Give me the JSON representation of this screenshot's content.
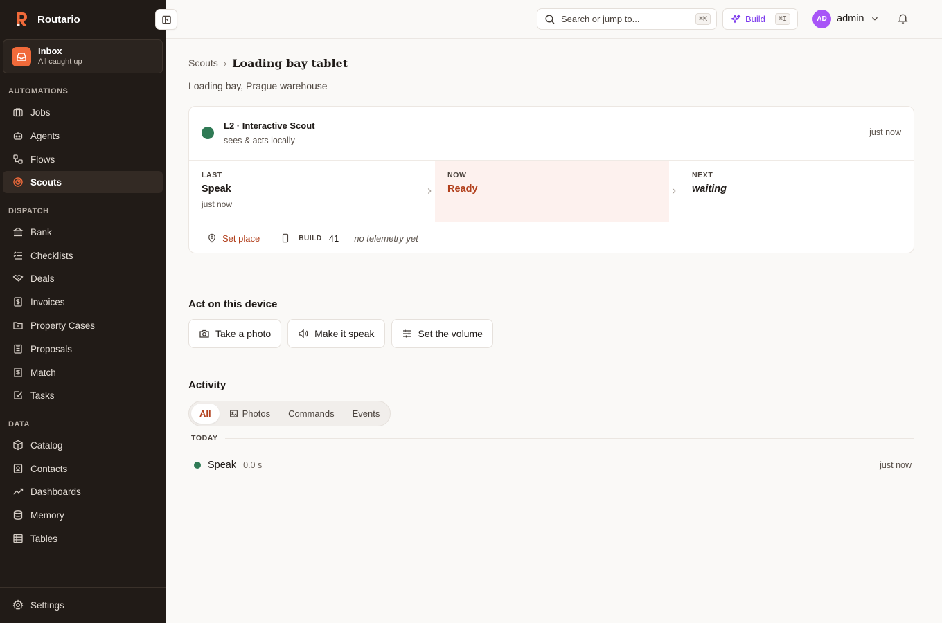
{
  "app": {
    "name": "Routario"
  },
  "sidebar": {
    "inbox": {
      "title": "Inbox",
      "subtitle": "All caught up"
    },
    "sections": [
      {
        "label": "AUTOMATIONS",
        "items": [
          {
            "label": "Jobs",
            "icon": "briefcase-icon"
          },
          {
            "label": "Agents",
            "icon": "bot-icon"
          },
          {
            "label": "Flows",
            "icon": "workflow-icon"
          },
          {
            "label": "Scouts",
            "icon": "radar-icon",
            "active": true
          }
        ]
      },
      {
        "label": "DISPATCH",
        "items": [
          {
            "label": "Bank",
            "icon": "bank-icon"
          },
          {
            "label": "Checklists",
            "icon": "checklist-icon"
          },
          {
            "label": "Deals",
            "icon": "handshake-icon"
          },
          {
            "label": "Invoices",
            "icon": "invoice-icon"
          },
          {
            "label": "Property Cases",
            "icon": "folder-icon"
          },
          {
            "label": "Proposals",
            "icon": "clipboard-icon"
          },
          {
            "label": "Match",
            "icon": "dollar-doc-icon"
          },
          {
            "label": "Tasks",
            "icon": "task-check-icon"
          }
        ]
      },
      {
        "label": "DATA",
        "items": [
          {
            "label": "Catalog",
            "icon": "box-icon"
          },
          {
            "label": "Contacts",
            "icon": "contact-icon"
          },
          {
            "label": "Dashboards",
            "icon": "trend-icon"
          },
          {
            "label": "Memory",
            "icon": "database-icon"
          },
          {
            "label": "Tables",
            "icon": "table-icon"
          }
        ]
      }
    ],
    "settings": {
      "label": "Settings",
      "icon": "gear-icon"
    }
  },
  "topbar": {
    "search_placeholder": "Search or jump to...",
    "search_shortcut": "⌘K",
    "build_label": "Build",
    "build_shortcut": "⌘I",
    "user_initials": "AD",
    "user_name": "admin"
  },
  "page": {
    "breadcrumb_parent": "Scouts",
    "breadcrumb_sep": "›",
    "title": "Loading bay tablet",
    "subtitle": "Loading bay, Prague warehouse"
  },
  "scout_card": {
    "type": "L2 · Interactive Scout",
    "description": "sees & acts locally",
    "updated": "just now",
    "status_color": "#2f7a55",
    "last": {
      "label": "LAST",
      "value": "Speak",
      "time": "just now"
    },
    "now": {
      "label": "NOW",
      "value": "Ready"
    },
    "next": {
      "label": "NEXT",
      "value": "waiting"
    },
    "set_place": "Set place",
    "build_label": "BUILD",
    "build_number": "41",
    "telemetry": "no telemetry yet"
  },
  "actions": {
    "title": "Act on this device",
    "buttons": [
      {
        "label": "Take a photo",
        "icon": "camera-icon"
      },
      {
        "label": "Make it speak",
        "icon": "speaker-icon"
      },
      {
        "label": "Set the volume",
        "icon": "sliders-icon"
      }
    ]
  },
  "activity": {
    "title": "Activity",
    "tabs": [
      {
        "label": "All",
        "active": true
      },
      {
        "label": "Photos",
        "icon": "image-icon"
      },
      {
        "label": "Commands"
      },
      {
        "label": "Events"
      }
    ],
    "day_label": "TODAY",
    "events": [
      {
        "name": "Speak",
        "duration": "0.0 s",
        "time": "just now"
      }
    ]
  },
  "colors": {
    "accent": "#b2401c",
    "brand": "#f06a3a",
    "sidebar_bg": "#211b17",
    "success": "#2f7a55",
    "build": "#7c3aed"
  }
}
